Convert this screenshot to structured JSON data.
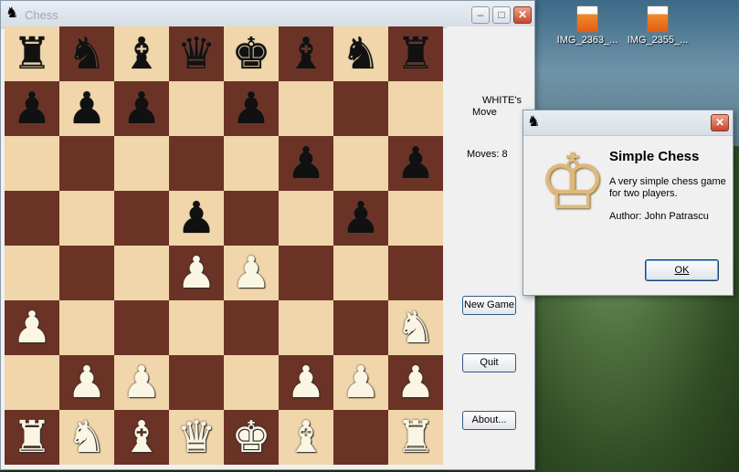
{
  "desktop": {
    "icons": [
      {
        "label": "IMG_2363_..."
      },
      {
        "label": "IMG_2355_..."
      }
    ]
  },
  "window": {
    "title": "Chess",
    "app_icon": "♞",
    "minimize": "–",
    "maximize": "□",
    "close": "✕"
  },
  "board": {
    "rows": [
      [
        "br",
        "bn",
        "bb",
        "bq",
        "bk",
        "bb",
        "bn",
        "br"
      ],
      [
        "bp",
        "bp",
        "bp",
        "",
        "bp",
        "",
        "",
        ""
      ],
      [
        "",
        "",
        "",
        "",
        "",
        "bp",
        "",
        "bp"
      ],
      [
        "",
        "",
        "",
        "bp",
        "",
        "",
        "bp",
        ""
      ],
      [
        "",
        "",
        "",
        "wp",
        "wp",
        "",
        "",
        ""
      ],
      [
        "wp",
        "",
        "",
        "",
        "",
        "",
        "",
        "wn"
      ],
      [
        "",
        "wp",
        "wp",
        "",
        "",
        "wp",
        "wp",
        "wp"
      ],
      [
        "wr",
        "wn",
        "wb",
        "wq",
        "wk",
        "wb",
        "",
        "wr"
      ]
    ]
  },
  "panel": {
    "status_line1": "WHITE's",
    "status_line2": "Move",
    "moves": "Moves: 8",
    "new_game": "New Game",
    "quit": "Quit",
    "about": "About..."
  },
  "about_dialog": {
    "icon": "♞",
    "close": "✕",
    "heading": "Simple Chess",
    "description": "A very simple chess game for two players.",
    "author": "Author: John Patrascu",
    "ok": "OK"
  }
}
